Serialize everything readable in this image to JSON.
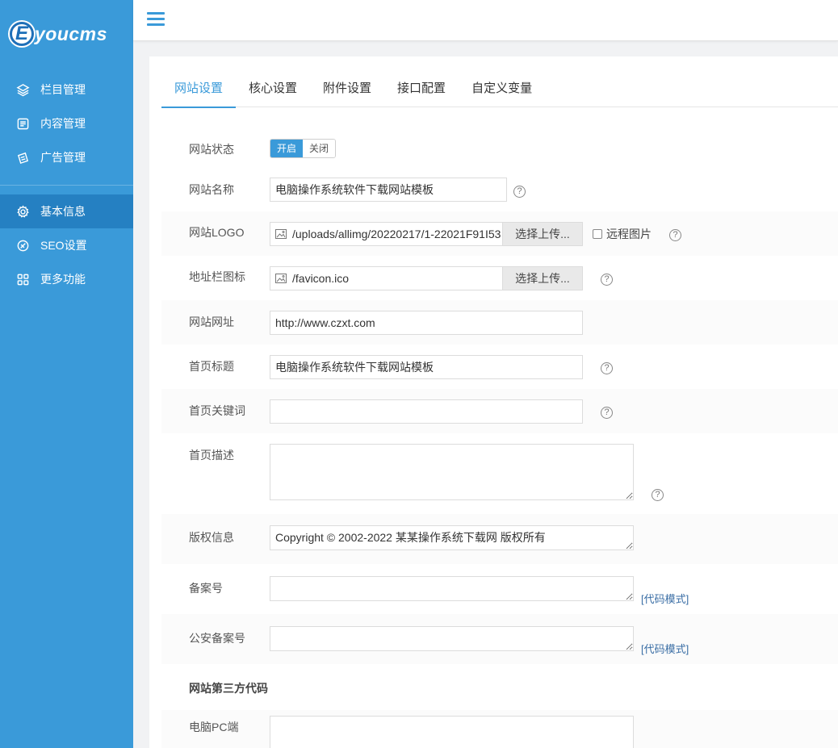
{
  "app": {
    "logo_letter": "E",
    "logo_text": "youcms"
  },
  "sidebar": {
    "items": [
      {
        "label": "栏目管理",
        "icon": "layers-icon"
      },
      {
        "label": "内容管理",
        "icon": "document-icon"
      },
      {
        "label": "广告管理",
        "icon": "ad-icon"
      },
      {
        "label": "基本信息",
        "icon": "gear-icon",
        "active": true
      },
      {
        "label": "SEO设置",
        "icon": "seo-icon"
      },
      {
        "label": "更多功能",
        "icon": "grid-icon"
      }
    ]
  },
  "tabs": [
    "网站设置",
    "核心设置",
    "附件设置",
    "接口配置",
    "自定义变量"
  ],
  "form": {
    "status": {
      "label": "网站状态",
      "on": "开启",
      "off": "关闭"
    },
    "name": {
      "label": "网站名称",
      "value": "电脑操作系统软件下载网站模板"
    },
    "logo": {
      "label": "网站LOGO",
      "value": "/uploads/allimg/20220217/1-22021F91I53",
      "button": "选择上传...",
      "remote": "远程图片"
    },
    "favicon": {
      "label": "地址栏图标",
      "value": "/favicon.ico",
      "button": "选择上传..."
    },
    "url": {
      "label": "网站网址",
      "value": "http://www.czxt.com"
    },
    "home_title": {
      "label": "首页标题",
      "value": "电脑操作系统软件下载网站模板"
    },
    "home_keywords": {
      "label": "首页关键词",
      "value": ""
    },
    "home_desc": {
      "label": "首页描述",
      "value": ""
    },
    "copyright": {
      "label": "版权信息",
      "value": "Copyright © 2002-2022 某某操作系统下载网 版权所有"
    },
    "icp": {
      "label": "备案号",
      "value": "",
      "code_mode": "[代码模式]"
    },
    "police": {
      "label": "公安备案号",
      "value": "",
      "code_mode": "[代码模式]"
    },
    "third_party_title": "网站第三方代码",
    "pc_code": {
      "label": "电脑PC端",
      "value": ""
    }
  },
  "help_glyph": "?",
  "colors": {
    "accent": "#3a9ad9",
    "sidebar_active": "#2580c2",
    "link": "#3a6ea5"
  }
}
